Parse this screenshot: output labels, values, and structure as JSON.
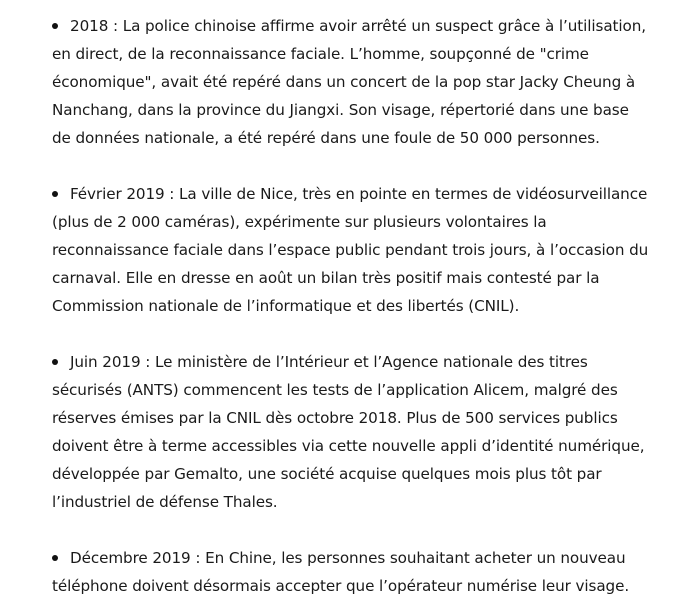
{
  "entries": [
    {
      "text": "2018 : La police chinoise affirme avoir arrêté un suspect grâce à l’utilisation, en direct, de la reconnaissance faciale. L’homme, soupçonné de \"crime économique\", avait été repéré dans un concert de la pop star Jacky Cheung à Nanchang, dans la province du Jiangxi. Son visage, répertorié dans une base de données nationale, a été repéré dans une foule de 50 000 personnes."
    },
    {
      "text": "Février 2019 : La ville de Nice, très en pointe en termes de vidéosurveillance (plus de 2 000 caméras), expérimente sur plusieurs volontaires la reconnaissance faciale dans l’espace public pendant trois jours, à l’occasion du carnaval. Elle en dresse en août un bilan très positif mais contesté par la Commission nationale de l’informatique et des libertés (CNIL)."
    },
    {
      "text": "Juin 2019 : Le ministère de l’Intérieur et l’Agence nationale des titres sécurisés (ANTS) commencent les tests de l’application Alicem, malgré des réserves émises par la CNIL dès octobre 2018. Plus de 500 services publics doivent être à terme accessibles via cette nouvelle appli d’identité numérique, développée par Gemalto, une société acquise quelques mois plus tôt par l’industriel de défense Thales."
    },
    {
      "text": "Décembre 2019 : En Chine, les personnes souhaitant acheter un nouveau téléphone doivent désormais accepter que l’opérateur numérise leur visage."
    }
  ]
}
